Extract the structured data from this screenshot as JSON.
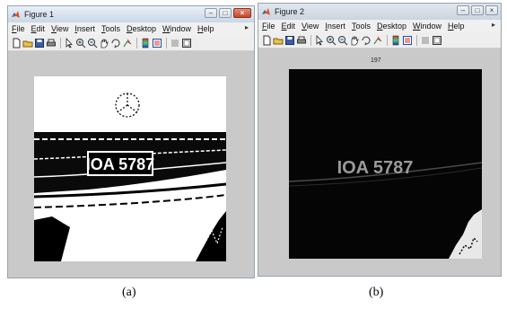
{
  "figure_a": {
    "title": "Figure 1",
    "menus": [
      {
        "label": "File",
        "u": "F"
      },
      {
        "label": "Edit",
        "u": "E"
      },
      {
        "label": "View",
        "u": "V"
      },
      {
        "label": "Insert",
        "u": "I"
      },
      {
        "label": "Tools",
        "u": "T"
      },
      {
        "label": "Desktop",
        "u": "D"
      },
      {
        "label": "Window",
        "u": "W"
      },
      {
        "label": "Help",
        "u": "H"
      }
    ],
    "plate_text": "IOA 5787",
    "caption": "(a)"
  },
  "figure_b": {
    "title": "Figure 2",
    "menus": [
      {
        "label": "File",
        "u": "F"
      },
      {
        "label": "Edit",
        "u": "E"
      },
      {
        "label": "View",
        "u": "V"
      },
      {
        "label": "Insert",
        "u": "I"
      },
      {
        "label": "Tools",
        "u": "T"
      },
      {
        "label": "Desktop",
        "u": "D"
      },
      {
        "label": "Window",
        "u": "W"
      },
      {
        "label": "Help",
        "u": "H"
      }
    ],
    "axes_title": "197",
    "plate_text": "IOA 5787",
    "caption": "(b)"
  },
  "toolbar_icons": [
    "new-file-icon",
    "open-folder-icon",
    "save-icon",
    "print-icon",
    "pointer-icon",
    "zoom-in-icon",
    "zoom-out-icon",
    "pan-hand-icon",
    "rotate-3d-icon",
    "data-cursor-icon",
    "colorbar-icon",
    "legend-icon",
    "hide-plot-tools-icon",
    "show-plot-tools-icon"
  ],
  "colors": {
    "window_bg": "#c9c9c9",
    "menubar": "#f0f0f0",
    "close_red": "#c7452a"
  }
}
